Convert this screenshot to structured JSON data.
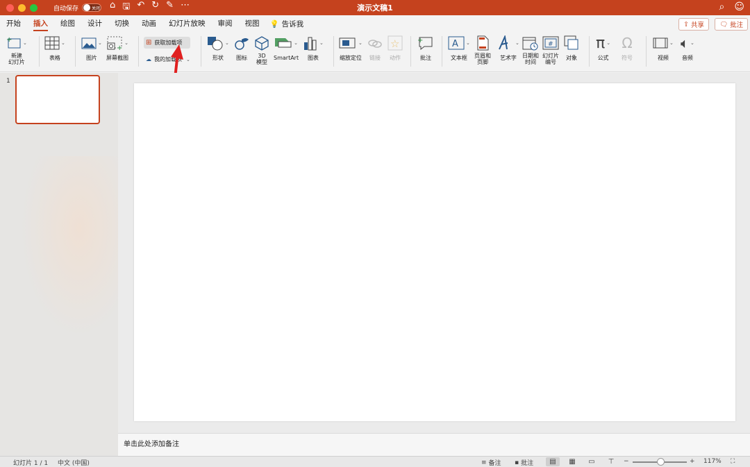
{
  "window": {
    "title": "演示文稿1",
    "autosave_label": "自动保存",
    "autosave_state": "关闭"
  },
  "tabs": [
    "开始",
    "插入",
    "绘图",
    "设计",
    "切换",
    "动画",
    "幻灯片放映",
    "审阅",
    "视图"
  ],
  "active_tab": "插入",
  "tell_me": "告诉我",
  "actions": {
    "share": "共享",
    "comments": "批注"
  },
  "ribbon": {
    "new_slide": "新建\n幻灯片",
    "table": "表格",
    "pictures": "图片",
    "screenshot": "屏幕截图",
    "get_addins": "获取加载项",
    "my_addins": "我的加载项",
    "shapes": "形状",
    "icons": "图标",
    "models_3d": "3D\n模型",
    "smartart": "SmartArt",
    "chart": "图表",
    "zoom": "缩放定位",
    "link": "链接",
    "action": "动作",
    "comment": "批注",
    "textbox": "文本框",
    "header_footer": "页眉和\n页脚",
    "wordart": "艺术字",
    "datetime": "日期和\n时间",
    "slide_number": "幻灯片\n编号",
    "object": "对象",
    "equation": "公式",
    "symbol": "符号",
    "video": "视频",
    "audio": "音频"
  },
  "slides_pane": {
    "slide_number": "1"
  },
  "notes_placeholder": "单击此处添加备注",
  "status": {
    "slide_info": "幻灯片 1 / 1",
    "language": "中文 (中国)",
    "notes": "备注",
    "comments": "批注",
    "zoom": "117%"
  },
  "colors": {
    "accent": "#c5421e",
    "icon_blue": "#2a5b8f"
  },
  "icons": [
    "search-icon",
    "smiley-icon",
    "home-icon",
    "save-icon",
    "undo-icon",
    "redo-icon",
    "lightbulb-icon"
  ]
}
